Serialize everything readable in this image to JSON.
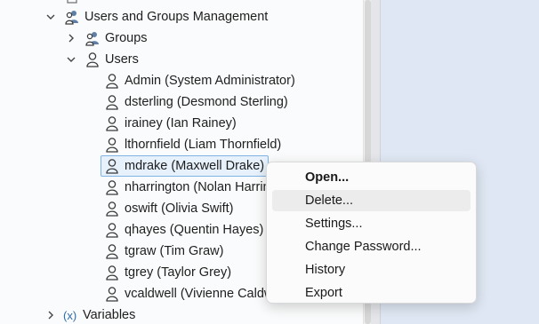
{
  "tree": {
    "root": {
      "label": "Users and Groups Management",
      "icon": "users-group-icon",
      "expanded": true
    },
    "groups": {
      "label": "Groups",
      "icon": "users-group-icon",
      "expanded": false
    },
    "users": {
      "label": "Users",
      "icon": "user-icon",
      "expanded": true
    },
    "user_list": [
      {
        "label": "Admin (System Administrator)",
        "icon": "user-icon"
      },
      {
        "label": "dsterling (Desmond Sterling)",
        "icon": "user-icon"
      },
      {
        "label": "irainey (Ian Rainey)",
        "icon": "user-icon"
      },
      {
        "label": "lthornfield (Liam Thornfield)",
        "icon": "user-icon"
      },
      {
        "label": "mdrake (Maxwell Drake)",
        "icon": "user-icon",
        "selected": true
      },
      {
        "label": "nharrington (Nolan Harrington)",
        "icon": "user-icon"
      },
      {
        "label": "oswift (Olivia Swift)",
        "icon": "user-icon"
      },
      {
        "label": "qhayes (Quentin Hayes)",
        "icon": "user-icon"
      },
      {
        "label": "tgraw (Tim Graw)",
        "icon": "user-icon"
      },
      {
        "label": "tgrey (Taylor Grey)",
        "icon": "user-icon"
      },
      {
        "label": "vcaldwell (Vivienne Caldwell)",
        "icon": "user-icon"
      }
    ],
    "variables": {
      "label": "Variables",
      "icon_text": "(x)",
      "expanded": false
    }
  },
  "context_menu": {
    "items": [
      {
        "label": "Open...",
        "bold": true
      },
      {
        "label": "Delete...",
        "hovered": true
      },
      {
        "label": "Settings..."
      },
      {
        "label": "Change Password..."
      },
      {
        "label": "History"
      },
      {
        "label": "Export"
      }
    ]
  },
  "colors": {
    "selection_bg": "#e6f1fb",
    "selection_border": "#7fb3e4",
    "right_pane": "#dfe7f4",
    "variables_icon": "#2b6cb0"
  }
}
